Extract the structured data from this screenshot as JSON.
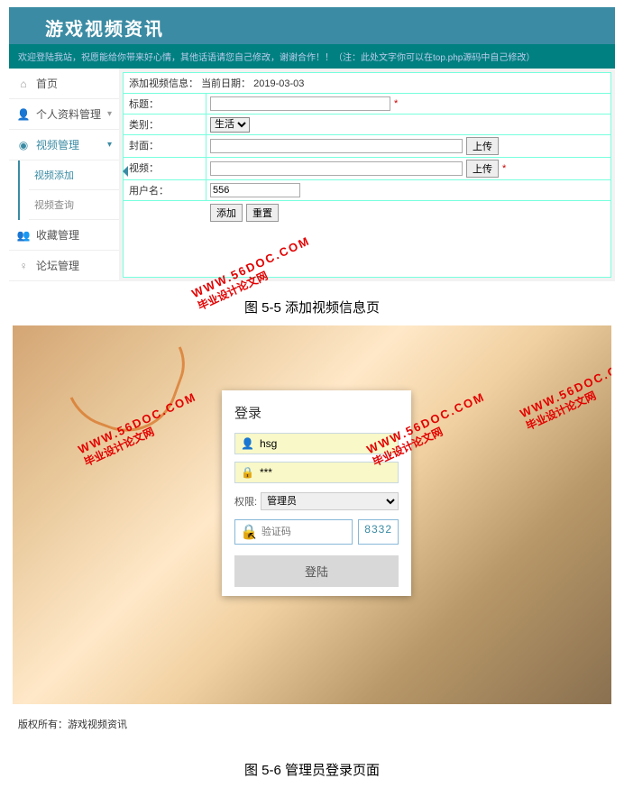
{
  "top": {
    "site_title": "游戏视频资讯",
    "welcome": "欢迎登陆我站，祝愿能给你带来好心情，其他话语请您自己修改，谢谢合作！！（注：此处文字你可以在top.php源码中自己修改）",
    "content_title_prefix": "添加视频信息：",
    "date_label": "当前日期：",
    "date_value": "2019-03-03",
    "sidebar": [
      {
        "icon": "⌂",
        "label": "首页",
        "chev": ""
      },
      {
        "icon": "👤",
        "label": "个人资料管理",
        "chev": "▾"
      },
      {
        "icon": "◉",
        "label": "视频管理",
        "chev": "▾",
        "active": true
      },
      {
        "icon": "👥",
        "label": "收藏管理",
        "chev": ""
      },
      {
        "icon": "♀",
        "label": "论坛管理",
        "chev": ""
      }
    ],
    "subside": [
      {
        "label": "视频添加",
        "current": true
      },
      {
        "label": "视频查询"
      }
    ],
    "form": {
      "title_label": "标题：",
      "title_req": "*",
      "cat_label": "类别：",
      "cat_value": "生活",
      "cover_label": "封面：",
      "cover_btn": "上传",
      "video_label": "视频：",
      "video_btn": "上传",
      "video_req": "*",
      "user_label": "用户名：",
      "user_value": "556",
      "submit": "添加",
      "reset": "重置"
    }
  },
  "caption1": "图 5-5  添加视频信息页",
  "login": {
    "heading": "登录",
    "username": "hsg",
    "password": "***",
    "role_label": "权限:",
    "role_value": "管理员",
    "captcha_placeholder": "验证码",
    "captcha_value": "8332",
    "submit": "登陆",
    "footer": "版权所有：游戏视频资讯"
  },
  "caption2": "图 5-6 管理员登录页面",
  "watermark": {
    "url": "WWW.56DOC.COM",
    "cn": "毕业设计论文网"
  }
}
